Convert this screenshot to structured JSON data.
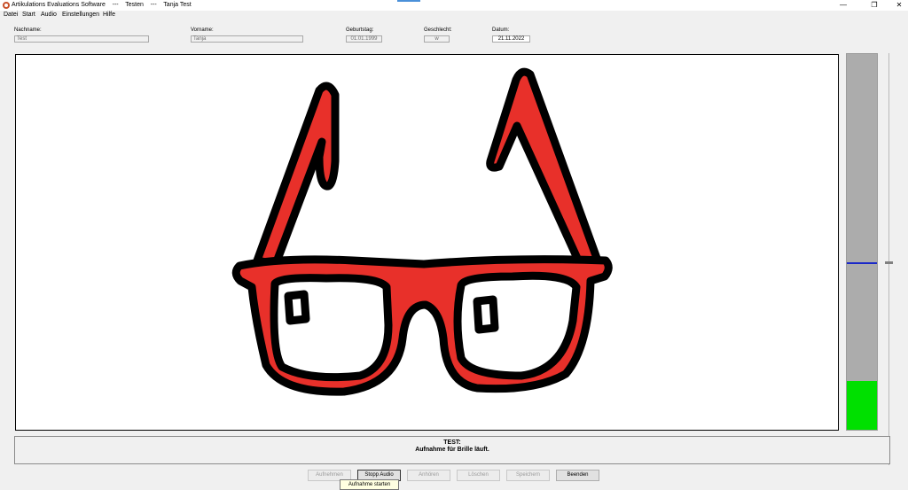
{
  "titlebar": {
    "title": "Artikulations Evaluations Software    ---    Testen    ---    Tanja Test",
    "minimize": "—",
    "restore": "❐",
    "close": "✕"
  },
  "menu": [
    "Datei",
    "Start",
    "Audio",
    "Einstellungen",
    "Hilfe"
  ],
  "fields": {
    "nachname": {
      "label": "Nachname:",
      "value": "Test"
    },
    "vorname": {
      "label": "Vorname:",
      "value": "Tanja"
    },
    "geburtstag": {
      "label": "Geburtstag:",
      "value": "01.01.1999"
    },
    "geschlecht": {
      "label": "Geschlecht:",
      "value": "w"
    },
    "datum": {
      "label": "Datum:",
      "value": "21.11.2022"
    }
  },
  "image": {
    "subject": "glasses",
    "color": "#e8302a"
  },
  "meter": {
    "level": 0.13,
    "marker": 0.555,
    "fill_color": "#00e000",
    "marker_color": "#1a28c8"
  },
  "status": {
    "title": "TEST:",
    "message": "Aufnahme für Brille läuft."
  },
  "buttons": {
    "aufnehmen": "Aufnehmen",
    "stopp_audio": "Stopp Audio",
    "anhoeren": "Anhören",
    "loeschen": "Löschen",
    "speichern": "Speichern",
    "beenden": "Beenden"
  },
  "tooltip": "Aufnahme starten"
}
